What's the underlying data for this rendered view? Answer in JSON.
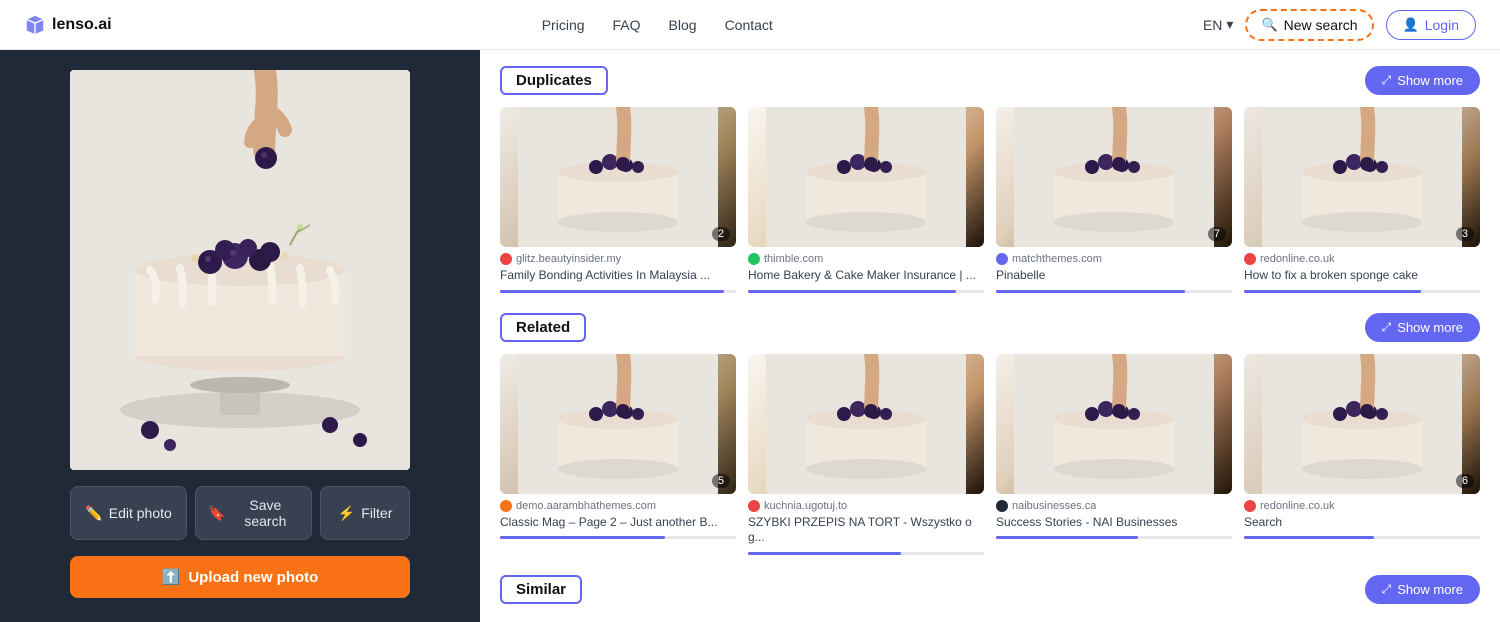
{
  "header": {
    "logo_text": "lenso.ai",
    "nav": [
      {
        "label": "Pricing",
        "id": "pricing"
      },
      {
        "label": "FAQ",
        "id": "faq"
      },
      {
        "label": "Blog",
        "id": "blog"
      },
      {
        "label": "Contact",
        "id": "contact"
      }
    ],
    "lang": "EN",
    "new_search_label": "New search",
    "login_label": "Login"
  },
  "left_panel": {
    "edit_photo_label": "Edit photo",
    "save_search_label": "Save search",
    "filter_label": "Filter",
    "upload_label": "Upload new photo"
  },
  "sections": [
    {
      "id": "duplicates",
      "label": "Duplicates",
      "show_more": "Show more",
      "cards": [
        {
          "source_name": "glitz.beautyinsider.my",
          "source_color": "#ef4444",
          "title": "Family Bonding Activities In Malaysia ...",
          "count": "2",
          "progress": 95
        },
        {
          "source_name": "thimble.com",
          "source_color": "#22c55e",
          "title": "Home Bakery & Cake Maker Insurance | ...",
          "count": null,
          "progress": 88
        },
        {
          "source_name": "matchthemes.com",
          "source_color": "#6366f1",
          "title": "Pinabelle",
          "count": "7",
          "progress": 80
        },
        {
          "source_name": "redonline.co.uk",
          "source_color": "#ef4444",
          "title": "How to fix a broken sponge cake",
          "count": "3",
          "progress": 75
        }
      ]
    },
    {
      "id": "related",
      "label": "Related",
      "show_more": "Show more",
      "cards": [
        {
          "source_name": "demo.aarambhathemes.com",
          "source_color": "#f97316",
          "title": "Classic Mag – Page 2 – Just another B...",
          "count": "5",
          "progress": 70
        },
        {
          "source_name": "kuchnia.ugotuj.to",
          "source_color": "#ef4444",
          "title": "SZYBKI PRZEPIS NA TORT - Wszystko o g...",
          "count": null,
          "progress": 65
        },
        {
          "source_name": "naibusinesses.ca",
          "source_color": "#1f2937",
          "title": "Success Stories - NAI Businesses",
          "count": null,
          "progress": 60
        },
        {
          "source_name": "redonline.co.uk",
          "source_color": "#ef4444",
          "title": "Search",
          "count": "6",
          "progress": 55
        }
      ]
    },
    {
      "id": "similar",
      "label": "Similar",
      "show_more": "Show more",
      "cards": []
    }
  ]
}
